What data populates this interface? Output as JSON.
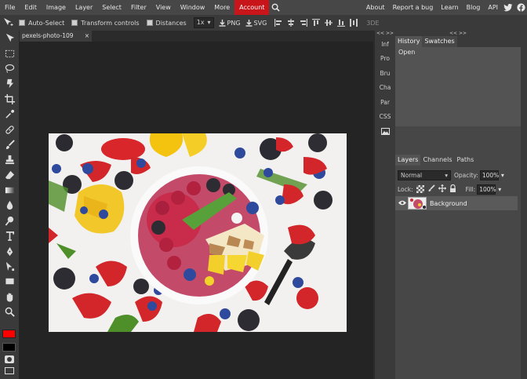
{
  "menu": {
    "items": [
      "File",
      "Edit",
      "Image",
      "Layer",
      "Select",
      "Filter",
      "View",
      "Window",
      "More",
      "Account"
    ],
    "active": "Account",
    "right_items": [
      "About",
      "Report a bug",
      "Learn",
      "Blog",
      "API"
    ]
  },
  "options": {
    "auto_select": "Auto-Select",
    "transform_controls": "Transform controls",
    "distances": "Distances",
    "zoom": "1x",
    "png": "PNG",
    "svg": "SVG",
    "three_d": "3DE"
  },
  "document": {
    "tab_label": "pexels-photo-109",
    "close": "×"
  },
  "mini_panel": {
    "arrows": "<< >>",
    "items": [
      "Inf",
      "Pro",
      "Bru",
      "Cha",
      "Par",
      "CSS"
    ]
  },
  "history_panel": {
    "arrows": "<< >>",
    "tabs": [
      "History",
      "Swatches"
    ],
    "rows": [
      "Open"
    ]
  },
  "layers_panel": {
    "tabs": [
      "Layers",
      "Channels",
      "Paths"
    ],
    "blend_mode": "Normal",
    "opacity_label": "Opacity:",
    "opacity_value": "100%",
    "lock_label": "Lock:",
    "fill_label": "Fill:",
    "fill_value": "100%",
    "layer_name": "Background"
  },
  "colors": {
    "accent": "#c8151a",
    "foreground": "#ff0000",
    "background": "#000000"
  }
}
